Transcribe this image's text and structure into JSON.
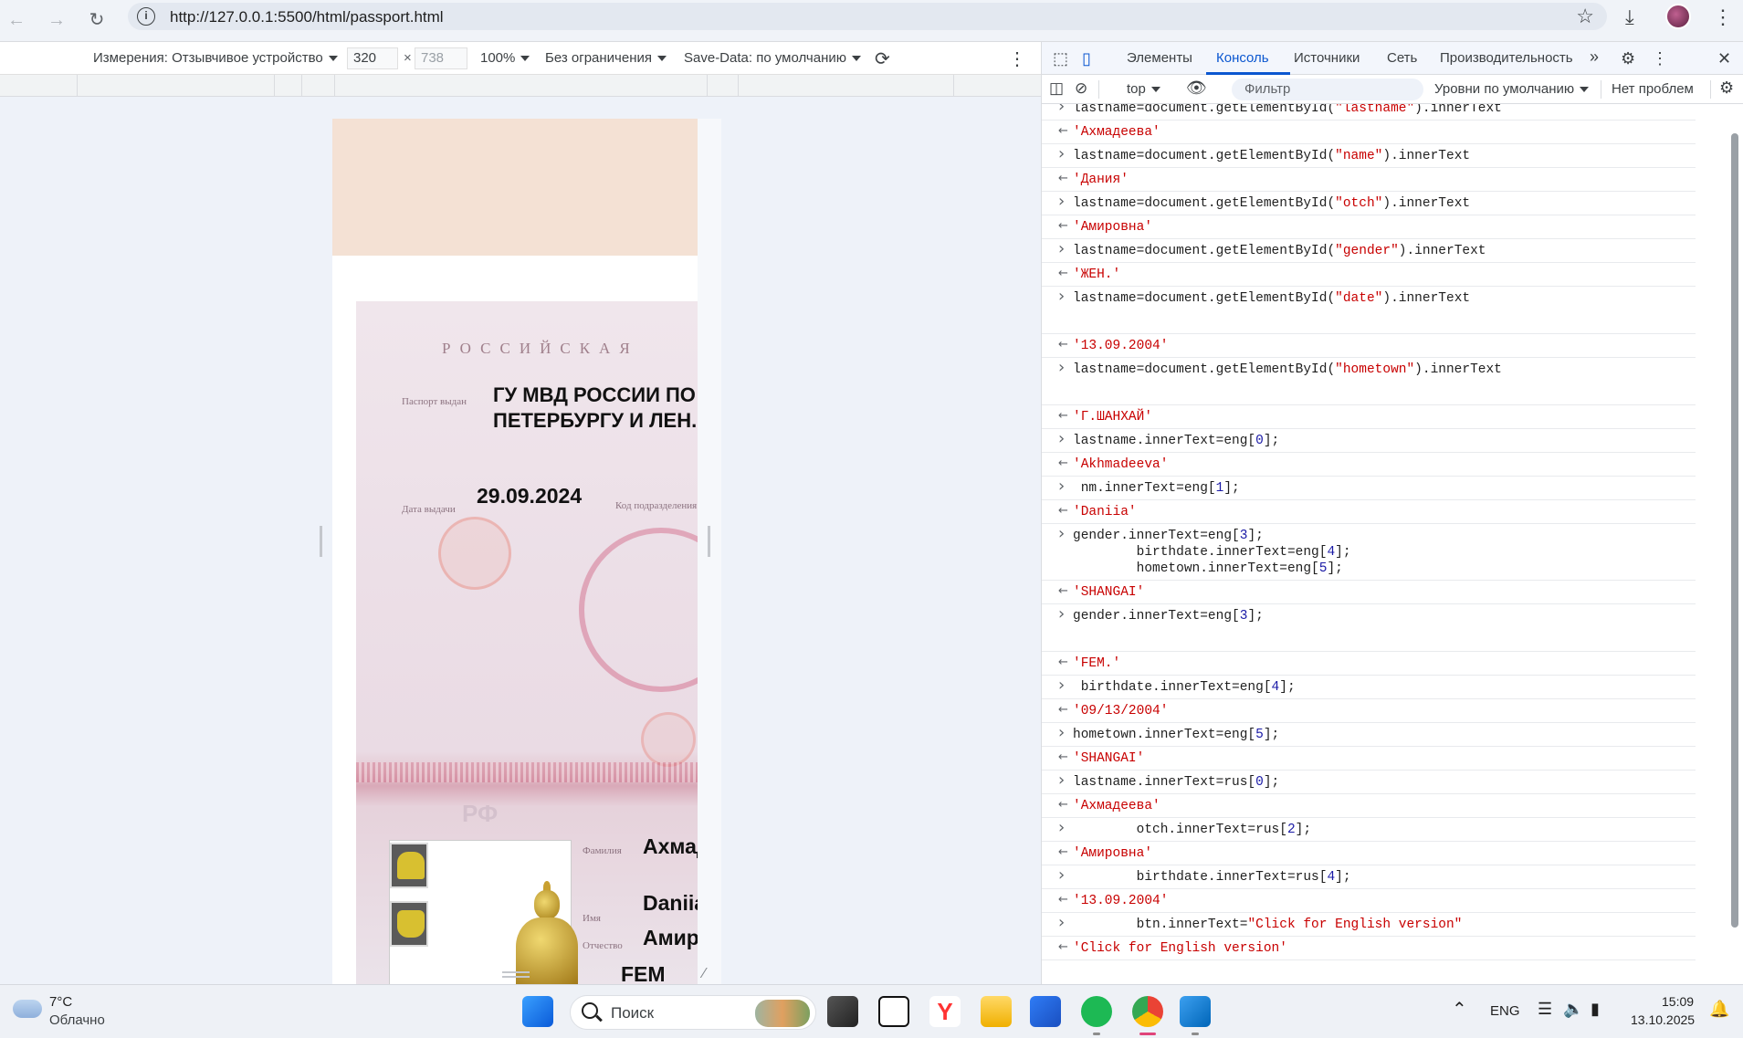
{
  "browser": {
    "url": "http://127.0.0.1:5500/html/passport.html"
  },
  "device_toolbar": {
    "dimensions_label": "Измерения: Отзывчивое устройство",
    "width": "320",
    "times": "×",
    "height": "738",
    "zoom": "100%",
    "throttle": "Без ограничения",
    "save_data": "Save-Data: по умолчанию"
  },
  "passport": {
    "country_caption": "РОССИЙСКАЯ",
    "issued_by_caption": "Паспорт выдан",
    "issued_by": [
      "ГУ МВД РОССИИ ПО",
      "ПЕТЕРБУРГУ И ЛЕН."
    ],
    "issue_date_caption": "Дата выдачи",
    "issue_date": "29.09.2024",
    "division_code_caption": "Код подразделения",
    "rf_mark": "РФ",
    "surname_caption": "Фамилия",
    "surname": "Ахмад",
    "name_caption": "Имя",
    "name": "Daniia",
    "patronymic_caption": "Отчество",
    "patronymic": "Амир",
    "gender_partial": "FEM"
  },
  "devtools": {
    "tabs": [
      "Элементы",
      "Консоль",
      "Источники",
      "Сеть",
      "Производительность"
    ],
    "active_tab": "Консоль",
    "more": "»",
    "console_toolbar": {
      "context": "top",
      "filter_placeholder": "Фильтр",
      "levels": "Уровни по умолчанию",
      "issues": "Нет проблем"
    }
  },
  "console": [
    {
      "type": "in",
      "lines": [
        "lastname=document.getElementById(\"lastname\").innerText"
      ]
    },
    {
      "type": "out",
      "lines": [
        "'Ахмадеева'"
      ]
    },
    {
      "type": "in",
      "lines": [
        "lastname=document.getElementById(\"name\").innerText"
      ]
    },
    {
      "type": "out",
      "lines": [
        "'Дания'"
      ]
    },
    {
      "type": "in",
      "lines": [
        "lastname=document.getElementById(\"otch\").innerText"
      ]
    },
    {
      "type": "out",
      "lines": [
        "'Амировна'"
      ]
    },
    {
      "type": "in",
      "lines": [
        "lastname=document.getElementById(\"gender\").innerText"
      ]
    },
    {
      "type": "out",
      "lines": [
        "'ЖЕН.'"
      ]
    },
    {
      "type": "in",
      "lines": [
        "lastname=document.getElementById(\"date\").innerText",
        ""
      ]
    },
    {
      "type": "out",
      "lines": [
        "'13.09.2004'"
      ]
    },
    {
      "type": "in",
      "lines": [
        "lastname=document.getElementById(\"hometown\").innerText",
        ""
      ]
    },
    {
      "type": "out",
      "lines": [
        "'Г.ШАНХАЙ'"
      ]
    },
    {
      "type": "in",
      "lines": [
        "lastname.innerText=eng[0];"
      ]
    },
    {
      "type": "out",
      "lines": [
        "'Akhmadeeva'"
      ]
    },
    {
      "type": "in",
      "lines": [
        " nm.innerText=eng[1];"
      ]
    },
    {
      "type": "out",
      "lines": [
        "'Daniia'"
      ]
    },
    {
      "type": "in",
      "lines": [
        "gender.innerText=eng[3];",
        "        birthdate.innerText=eng[4];",
        "        hometown.innerText=eng[5];"
      ]
    },
    {
      "type": "out",
      "lines": [
        "'SHANGAI'"
      ]
    },
    {
      "type": "in",
      "lines": [
        "gender.innerText=eng[3];",
        ""
      ]
    },
    {
      "type": "out",
      "lines": [
        "'FEM.'"
      ]
    },
    {
      "type": "in",
      "lines": [
        " birthdate.innerText=eng[4];"
      ]
    },
    {
      "type": "out",
      "lines": [
        "'09/13/2004'"
      ]
    },
    {
      "type": "in",
      "lines": [
        "hometown.innerText=eng[5];"
      ]
    },
    {
      "type": "out",
      "lines": [
        "'SHANGAI'"
      ]
    },
    {
      "type": "in",
      "lines": [
        "lastname.innerText=rus[0];"
      ]
    },
    {
      "type": "out",
      "lines": [
        "'Ахмадеева'"
      ]
    },
    {
      "type": "in",
      "lines": [
        "        otch.innerText=rus[2];"
      ]
    },
    {
      "type": "out",
      "lines": [
        "'Амировна'"
      ]
    },
    {
      "type": "in",
      "lines": [
        "        birthdate.innerText=rus[4];"
      ]
    },
    {
      "type": "out",
      "lines": [
        "'13.09.2004'"
      ]
    },
    {
      "type": "in",
      "lines": [
        "        btn.innerText=\"Click for English version\""
      ]
    },
    {
      "type": "out",
      "lines": [
        "'Click for English version'"
      ]
    }
  ],
  "taskbar": {
    "weather_temp": "7°C",
    "weather_desc": "Облачно",
    "search_label": "Поиск",
    "lang": "ENG",
    "time": "15:09",
    "date": "13.10.2025"
  }
}
